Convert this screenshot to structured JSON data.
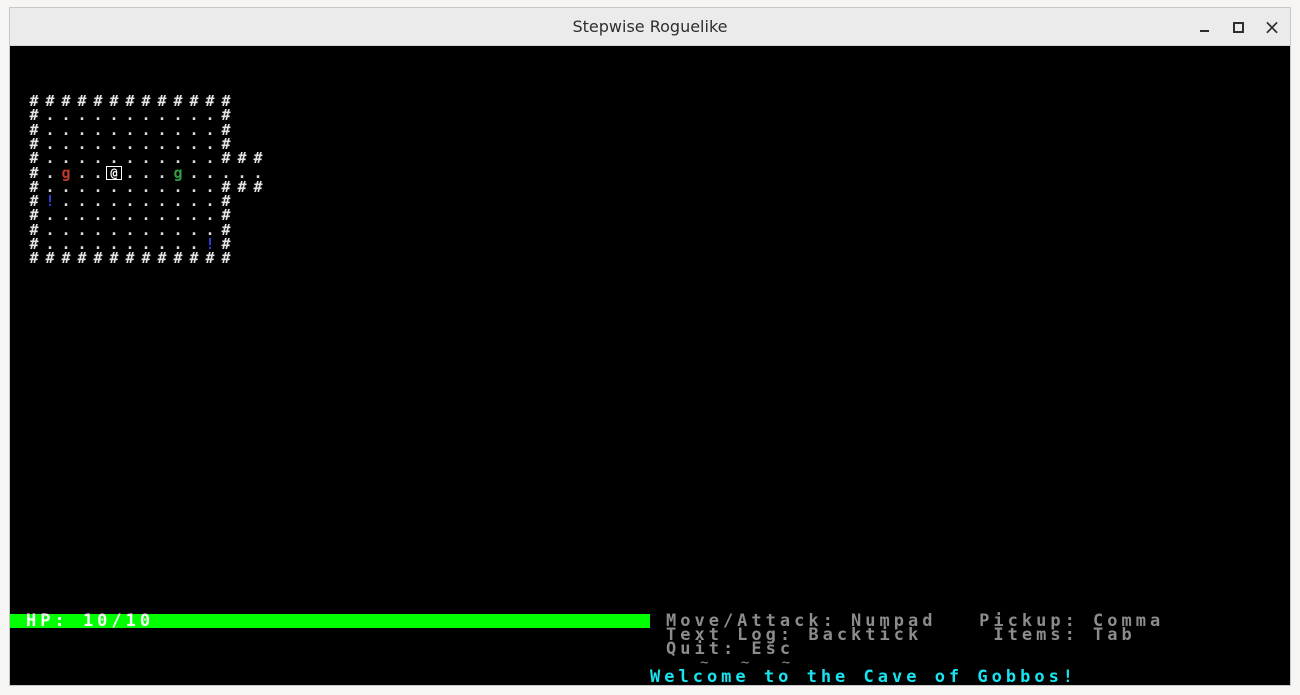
{
  "window": {
    "title": "Stepwise Roguelike",
    "minimize_label": "minimize",
    "maximize_label": "maximize",
    "close_glyph": "×"
  },
  "map": {
    "rows": [
      "#############  ",
      "#...........#  ",
      "#...........#  ",
      "#...........#  ",
      "#...........###",
      "#.g..@...g.....",
      "#...........###",
      "#!..........#  ",
      "#...........#  ",
      "#...........#  ",
      "#..........!#  ",
      "#############  "
    ],
    "legend": {
      "wall": "#",
      "floor": ".",
      "player": "@",
      "goblin": "g",
      "potion": "!"
    },
    "colors": {
      "wall": "#e4e4e4",
      "floor": "#dcdcdc",
      "goblin_hostile": "#c0392b",
      "goblin_other": "#2ea043",
      "potion": "#2f3fd8",
      "player": "#ffffff"
    },
    "special": [
      {
        "row": 5,
        "col": 2,
        "kind": "goblin-red"
      },
      {
        "row": 5,
        "col": 5,
        "kind": "player"
      },
      {
        "row": 5,
        "col": 9,
        "kind": "goblin-green"
      },
      {
        "row": 7,
        "col": 1,
        "kind": "potion"
      },
      {
        "row": 10,
        "col": 11,
        "kind": "potion"
      }
    ]
  },
  "status": {
    "hp_text": "HP: 10/10",
    "hp_current": 10,
    "hp_max": 10,
    "hp_bar_color": "#00ff00"
  },
  "help": {
    "line1": "Move/Attack: Numpad   Pickup: Comma",
    "line2": "Text Log: Backtick     Items: Tab",
    "line3": "Quit: Esc",
    "separator": "~ ~ ~"
  },
  "log": {
    "latest": "Welcome to the Cave of Gobbos!",
    "color": "#18e4f0"
  }
}
